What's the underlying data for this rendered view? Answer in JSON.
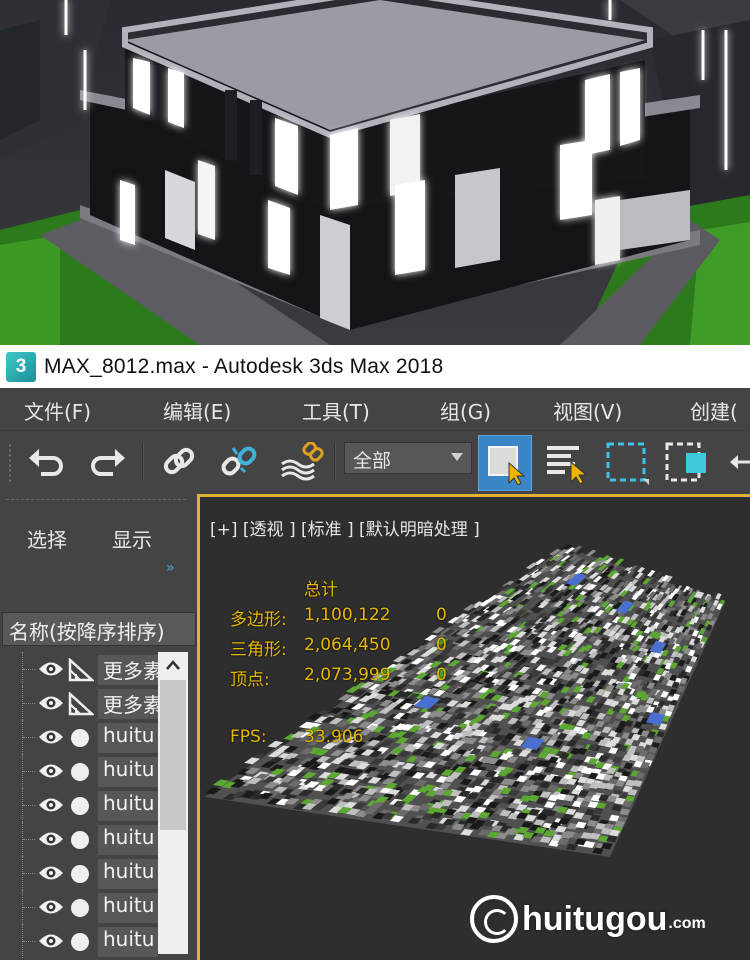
{
  "window": {
    "app_icon": "3",
    "title": "MAX_8012.max - Autodesk 3ds Max 2018"
  },
  "menu": [
    {
      "label": "文件(F)"
    },
    {
      "label": "编辑(E)"
    },
    {
      "label": "工具(T)"
    },
    {
      "label": "组(G)"
    },
    {
      "label": "视图(V)"
    },
    {
      "label": "创建("
    }
  ],
  "toolbar": {
    "selection_filter": "全部",
    "icons": [
      "undo-icon",
      "redo-icon",
      "link-icon",
      "unlink-icon",
      "bind-spacewarp-icon",
      "select-object-icon",
      "select-by-name-icon",
      "rect-region-icon",
      "window-crossing-icon"
    ]
  },
  "explorer": {
    "tabs": [
      "选择",
      "显示"
    ],
    "column_header": "名称(按降序排序)",
    "rows": [
      {
        "kind": "camera",
        "name": "更多素"
      },
      {
        "kind": "camera",
        "name": "更多素"
      },
      {
        "kind": "geometry",
        "name": "huitu"
      },
      {
        "kind": "geometry",
        "name": "huitu"
      },
      {
        "kind": "geometry",
        "name": "huitu"
      },
      {
        "kind": "geometry",
        "name": "huitu"
      },
      {
        "kind": "geometry",
        "name": "huitu"
      },
      {
        "kind": "geometry",
        "name": "huitu"
      },
      {
        "kind": "geometry",
        "name": "huitu"
      }
    ]
  },
  "viewport": {
    "label": "[+] [透视 ] [标准 ] [默认明暗处理 ]",
    "stats": {
      "total_label": "总计",
      "polygons_label": "多边形:",
      "polygons_value": "1,100,122",
      "polygons_sel": "0",
      "triangles_label": "三角形:",
      "triangles_value": "2,064,450",
      "triangles_sel": "0",
      "vertices_label": "顶点:",
      "vertices_value": "2,073,999",
      "vertices_sel": "0",
      "fps_label": "FPS:",
      "fps_value": "33.906"
    }
  },
  "watermark": {
    "brand": "huitugou",
    "domain": ".com"
  },
  "colors": {
    "accent_viewport_border": "#e0b23a",
    "stats_text": "#e6b800",
    "ui_background": "#444444",
    "selected_tool": "#3c86c8"
  }
}
